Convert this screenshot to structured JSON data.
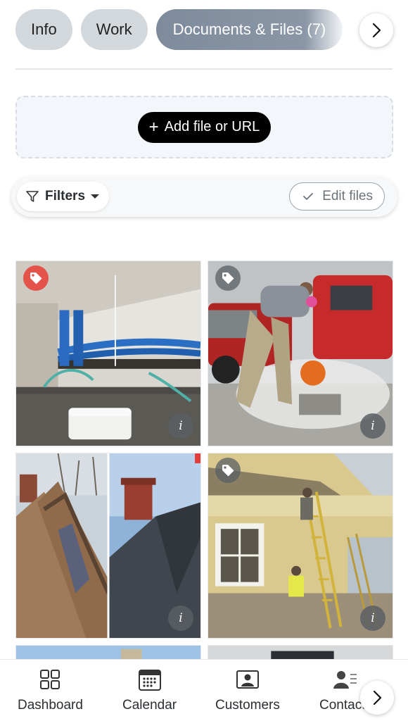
{
  "tabs": [
    {
      "label": "Info",
      "active": false
    },
    {
      "label": "Work",
      "active": false
    },
    {
      "label": "Documents & Files (7)",
      "active": true
    }
  ],
  "upload": {
    "add_label": "Add file or URL"
  },
  "filterbar": {
    "filters_label": "Filters",
    "edit_label": "Edit files"
  },
  "gallery": [
    {
      "icon": "tag-icon",
      "tag_color": "#e4534a",
      "info": "i"
    },
    {
      "icon": "tag-icon",
      "tag_color": "#5a5f64",
      "info": "i"
    },
    {
      "icon": "none",
      "info": "i"
    },
    {
      "icon": "tag-icon",
      "tag_color": "#5a5f64",
      "info": "i"
    }
  ],
  "bottomnav": {
    "items": [
      {
        "label": "Dashboard",
        "icon": "grid-icon"
      },
      {
        "label": "Calendar",
        "icon": "calendar-icon"
      },
      {
        "label": "Customers",
        "icon": "customer-card-icon"
      },
      {
        "label": "Contacts",
        "icon": "contacts-icon"
      }
    ]
  }
}
